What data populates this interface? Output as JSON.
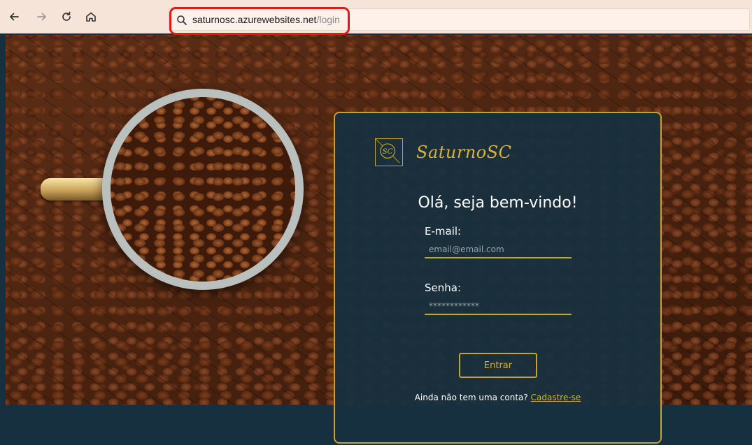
{
  "browser": {
    "url_host": "saturnosc.azurewebsites.net",
    "url_path": "/login"
  },
  "icons": {
    "back": "arrow-left-icon",
    "forward": "arrow-right-icon",
    "reload": "reload-icon",
    "home": "home-icon",
    "search": "search-icon",
    "logo": "sc-logo-icon"
  },
  "login": {
    "logo_text": "SaturnoSC",
    "logo_monogram": "SC",
    "welcome": "Olá, seja bem-vindo!",
    "email_label": "E-mail:",
    "email_placeholder": "email@email.com",
    "password_label": "Senha:",
    "password_placeholder": "************",
    "submit_label": "Entrar",
    "signup_prompt": "Ainda não tem uma conta?",
    "signup_link": "Cadastre-se"
  },
  "colors": {
    "accent_gold": "#c9a227",
    "card_bg": "#17303f",
    "highlight_red": "#e01919"
  }
}
